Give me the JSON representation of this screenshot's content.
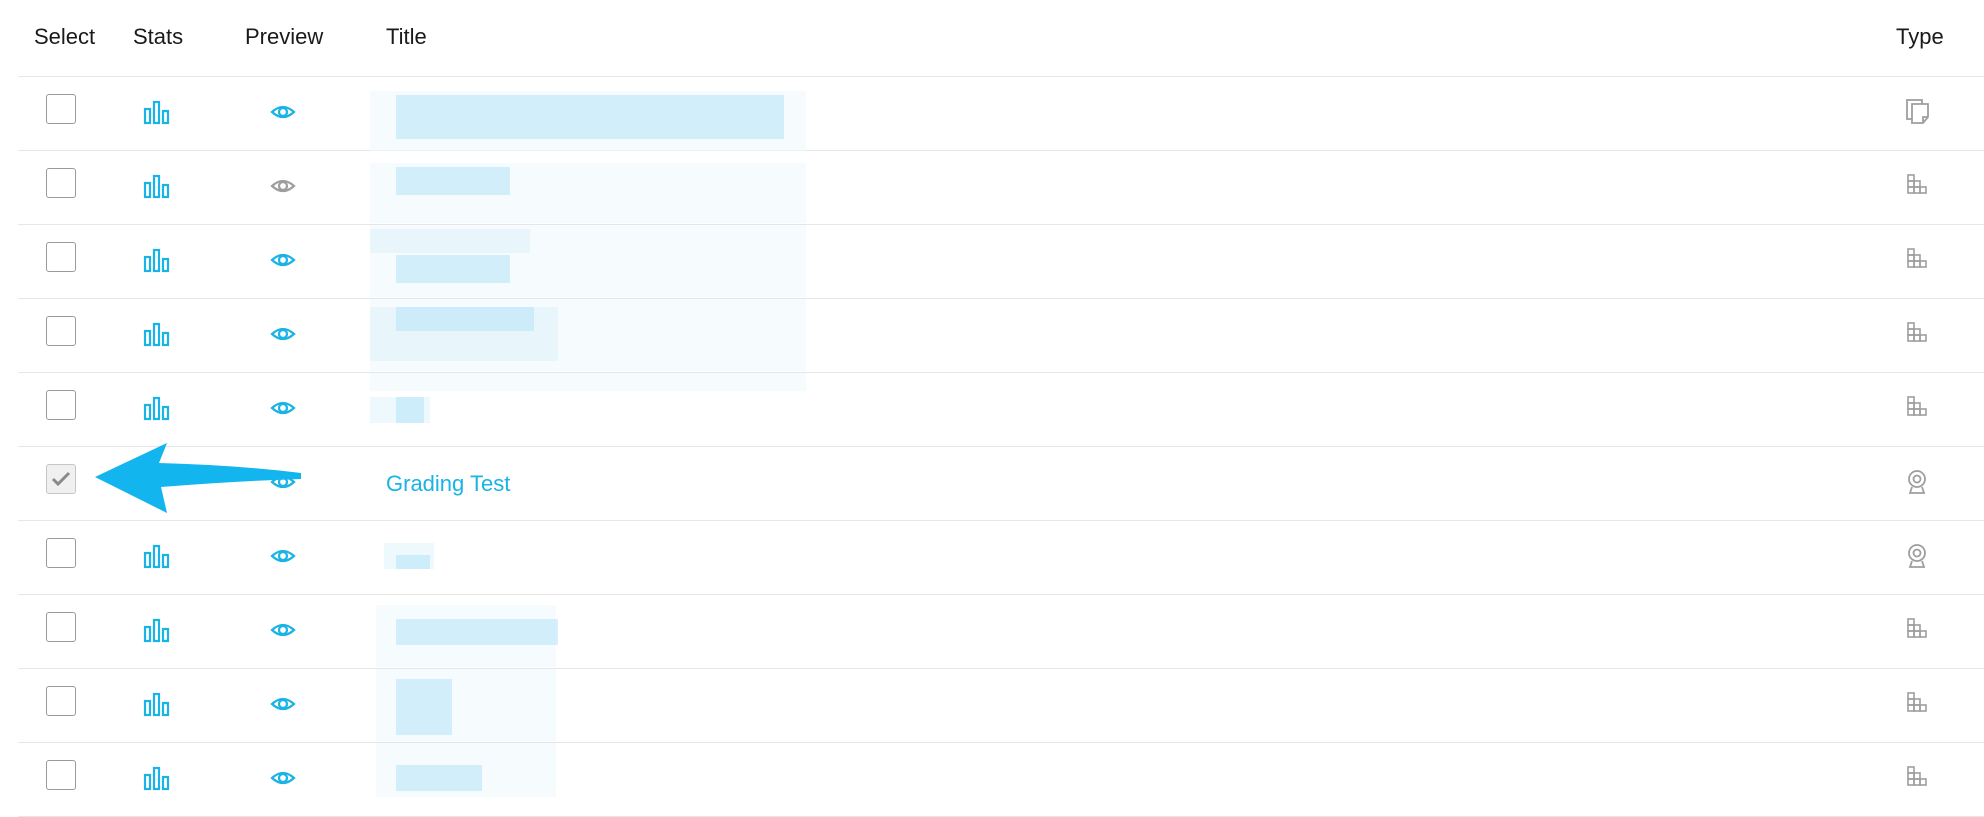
{
  "columns": {
    "select": "Select",
    "stats": "Stats",
    "preview": "Preview",
    "title": "Title",
    "type": "Type"
  },
  "colors": {
    "accent": "#19b3e6",
    "muted_icon": "#9e9e9e",
    "divider": "#e6e6e6",
    "annotation_arrow": "#12b5ee"
  },
  "rows": [
    {
      "selected": false,
      "preview_active": true,
      "title": "",
      "type_icon": "document-icon"
    },
    {
      "selected": false,
      "preview_active": false,
      "title": "",
      "type_icon": "building-blocks-icon"
    },
    {
      "selected": false,
      "preview_active": true,
      "title": "",
      "type_icon": "building-blocks-icon"
    },
    {
      "selected": false,
      "preview_active": true,
      "title": "",
      "type_icon": "building-blocks-icon"
    },
    {
      "selected": false,
      "preview_active": true,
      "title": "",
      "type_icon": "building-blocks-icon"
    },
    {
      "selected": true,
      "preview_active": true,
      "title": "Grading Test",
      "type_icon": "webcam-icon"
    },
    {
      "selected": false,
      "preview_active": true,
      "title": "",
      "type_icon": "webcam-icon"
    },
    {
      "selected": false,
      "preview_active": true,
      "title": "",
      "type_icon": "building-blocks-icon"
    },
    {
      "selected": false,
      "preview_active": true,
      "title": "",
      "type_icon": "building-blocks-icon"
    },
    {
      "selected": false,
      "preview_active": true,
      "title": "",
      "type_icon": "building-blocks-icon"
    }
  ]
}
